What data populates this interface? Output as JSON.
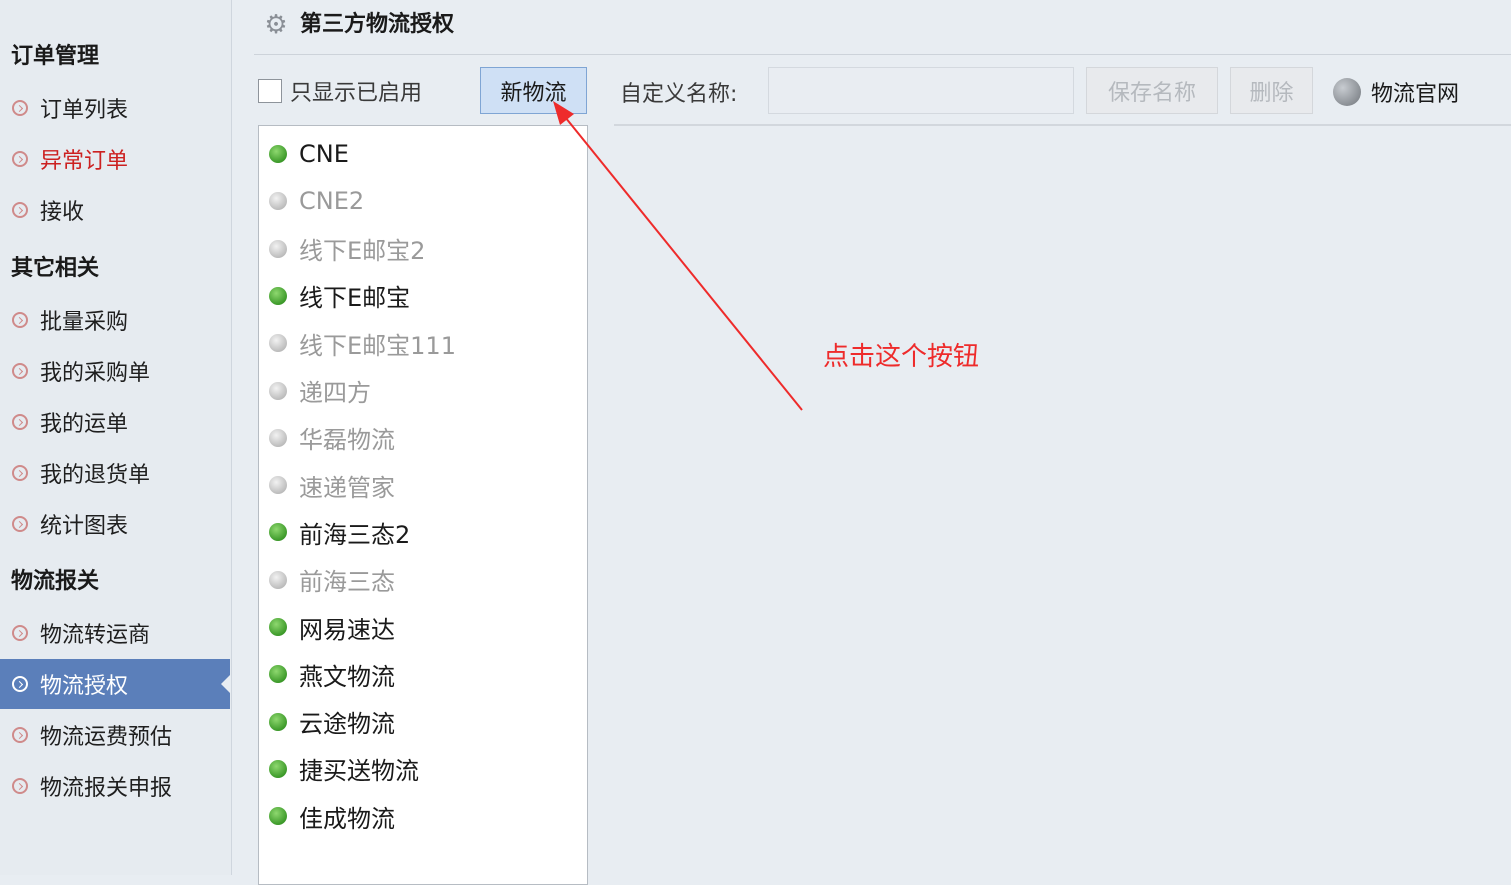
{
  "sidebar": {
    "sections": [
      {
        "title": "订单管理",
        "items": [
          {
            "label": "订单列表",
            "state": "normal"
          },
          {
            "label": "异常订单",
            "state": "warning"
          },
          {
            "label": "接收",
            "state": "normal"
          }
        ]
      },
      {
        "title": "其它相关",
        "items": [
          {
            "label": "批量采购",
            "state": "normal"
          },
          {
            "label": "我的采购单",
            "state": "normal"
          },
          {
            "label": "我的运单",
            "state": "normal"
          },
          {
            "label": "我的退货单",
            "state": "normal"
          },
          {
            "label": "统计图表",
            "state": "normal"
          }
        ]
      },
      {
        "title": "物流报关",
        "items": [
          {
            "label": "物流转运商",
            "state": "normal"
          },
          {
            "label": "物流授权",
            "state": "active"
          },
          {
            "label": "物流运费预估",
            "state": "normal"
          },
          {
            "label": "物流报关申报",
            "state": "normal"
          }
        ]
      }
    ]
  },
  "header": {
    "title": "第三方物流授权",
    "icon": "gear-icon"
  },
  "toolbar": {
    "filter_label": "只显示已启用",
    "filter_checked": false,
    "new_button": "新物流",
    "name_label": "自定义名称:",
    "name_value": "",
    "save_button": "保存名称",
    "delete_button": "删除",
    "site_link": "物流官网",
    "site_icon": "globe-icon"
  },
  "logistics": [
    {
      "name": "CNE",
      "enabled": true
    },
    {
      "name": "CNE2",
      "enabled": false
    },
    {
      "name": "线下E邮宝2",
      "enabled": false
    },
    {
      "name": "线下E邮宝",
      "enabled": true
    },
    {
      "name": "线下E邮宝111",
      "enabled": false
    },
    {
      "name": "递四方",
      "enabled": false
    },
    {
      "name": "华磊物流",
      "enabled": false
    },
    {
      "name": "速递管家",
      "enabled": false
    },
    {
      "name": "前海三态2",
      "enabled": true
    },
    {
      "name": "前海三态",
      "enabled": false
    },
    {
      "name": "网易速达",
      "enabled": true
    },
    {
      "name": "燕文物流",
      "enabled": true
    },
    {
      "name": "云途物流",
      "enabled": true
    },
    {
      "name": "捷买送物流",
      "enabled": true
    },
    {
      "name": "佳成物流",
      "enabled": true
    }
  ],
  "annotation": {
    "text": "点击这个按钮",
    "color": "#ee2b2b"
  },
  "colors": {
    "enabled": "#3d9a2a",
    "disabled": "#bdbdbd",
    "active_nav": "#5b7fba",
    "warning": "#cc2020"
  }
}
